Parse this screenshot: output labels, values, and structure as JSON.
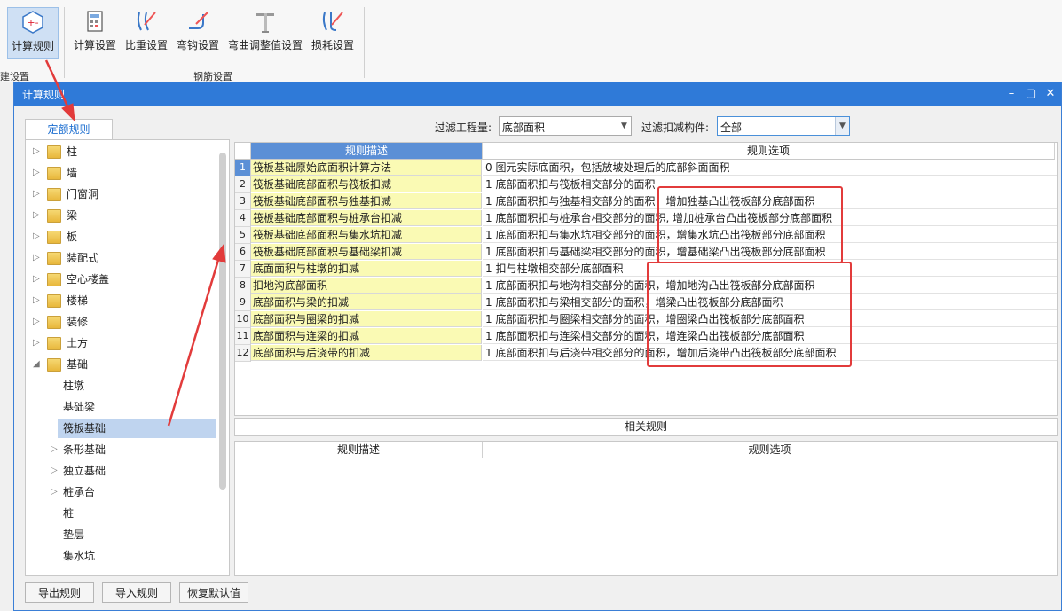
{
  "ribbon": {
    "buttons": [
      {
        "label": "计算规则",
        "icon": "calc-rule-icon"
      },
      {
        "label": "计算设置",
        "icon": "calc-settings-icon"
      },
      {
        "label": "比重设置",
        "icon": "gravity-settings-icon"
      },
      {
        "label": "弯钩设置",
        "icon": "hook-settings-icon"
      },
      {
        "label": "弯曲调整值设置",
        "icon": "bend-adjust-icon"
      },
      {
        "label": "损耗设置",
        "icon": "loss-settings-icon"
      }
    ],
    "groups": [
      "建设置",
      "钢筋设置"
    ]
  },
  "dialog": {
    "title": "计算规则",
    "tab_label": "定额规则",
    "filter_quantity_label": "过滤工程量:",
    "filter_quantity_value": "底部面积",
    "filter_component_label": "过滤扣减构件:",
    "filter_component_value": "全部"
  },
  "tree": [
    {
      "label": "柱",
      "type": "folder"
    },
    {
      "label": "墙",
      "type": "folder"
    },
    {
      "label": "门窗洞",
      "type": "folder"
    },
    {
      "label": "梁",
      "type": "folder"
    },
    {
      "label": "板",
      "type": "folder"
    },
    {
      "label": "装配式",
      "type": "folder"
    },
    {
      "label": "空心楼盖",
      "type": "folder"
    },
    {
      "label": "楼梯",
      "type": "folder"
    },
    {
      "label": "装修",
      "type": "folder"
    },
    {
      "label": "土方",
      "type": "folder"
    },
    {
      "label": "基础",
      "type": "folder-open"
    },
    {
      "label": "柱墩",
      "type": "leaf"
    },
    {
      "label": "基础梁",
      "type": "leaf"
    },
    {
      "label": "筏板基础",
      "type": "leaf-selected"
    },
    {
      "label": "条形基础",
      "type": "child-collapsed"
    },
    {
      "label": "独立基础",
      "type": "child-collapsed"
    },
    {
      "label": "桩承台",
      "type": "child-collapsed"
    },
    {
      "label": "桩",
      "type": "leaf"
    },
    {
      "label": "垫层",
      "type": "leaf"
    },
    {
      "label": "集水坑",
      "type": "leaf"
    }
  ],
  "grid": {
    "header_desc": "规则描述",
    "header_option": "规则选项",
    "rows": [
      {
        "n": "1",
        "desc": "筏板基础原始底面积计算方法",
        "opt": "0 图元实际底面积，包括放坡处理后的底部斜面面积"
      },
      {
        "n": "2",
        "desc": "筏板基础底部面积与筏板扣减",
        "opt": "1 底部面积扣与筏板相交部分的面积"
      },
      {
        "n": "3",
        "desc": "筏板基础底部面积与独基扣减",
        "opt": "1 底部面积扣与独基相交部分的面积，增加独基凸出筏板部分底部面积"
      },
      {
        "n": "4",
        "desc": "筏板基础底部面积与桩承台扣减",
        "opt": "1 底部面积扣与桩承台相交部分的面积, 增加桩承台凸出筏板部分底部面积"
      },
      {
        "n": "5",
        "desc": "筏板基础底部面积与集水坑扣减",
        "opt": "1 底部面积扣与集水坑相交部分的面积，增集水坑凸出筏板部分底部面积"
      },
      {
        "n": "6",
        "desc": "筏板基础底部面积与基础梁扣减",
        "opt": "1 底部面积扣与基础梁相交部分的面积，增基础梁凸出筏板部分底部面积"
      },
      {
        "n": "7",
        "desc": "底面面积与柱墩的扣减",
        "opt": "1 扣与柱墩相交部分底部面积"
      },
      {
        "n": "8",
        "desc": "扣地沟底部面积",
        "opt": "1 底部面积扣与地沟相交部分的面积，增加地沟凸出筏板部分底部面积"
      },
      {
        "n": "9",
        "desc": "底部面积与梁的扣减",
        "opt": "1 底部面积扣与梁相交部分的面积，增梁凸出筏板部分底部面积"
      },
      {
        "n": "10",
        "desc": "底部面积与圈梁的扣减",
        "opt": "1 底部面积扣与圈梁相交部分的面积，增圈梁凸出筏板部分底部面积"
      },
      {
        "n": "11",
        "desc": "底部面积与连梁的扣减",
        "opt": "1 底部面积扣与连梁相交部分的面积，增连梁凸出筏板部分底部面积"
      },
      {
        "n": "12",
        "desc": "底部面积与后浇带的扣减",
        "opt": "1 底部面积扣与后浇带相交部分的面积，增加后浇带凸出筏板部分底部面积"
      }
    ]
  },
  "related": {
    "title": "相关规则",
    "header_desc": "规则描述",
    "header_option": "规则选项"
  },
  "buttons": {
    "export": "导出规则",
    "import": "导入规则",
    "restore": "恢复默认值"
  },
  "colors": {
    "title_bar": "#2f7ad8",
    "grid_header": "#5b8fd6",
    "desc_cell": "#fafab4",
    "annotation": "#e23b3b"
  }
}
